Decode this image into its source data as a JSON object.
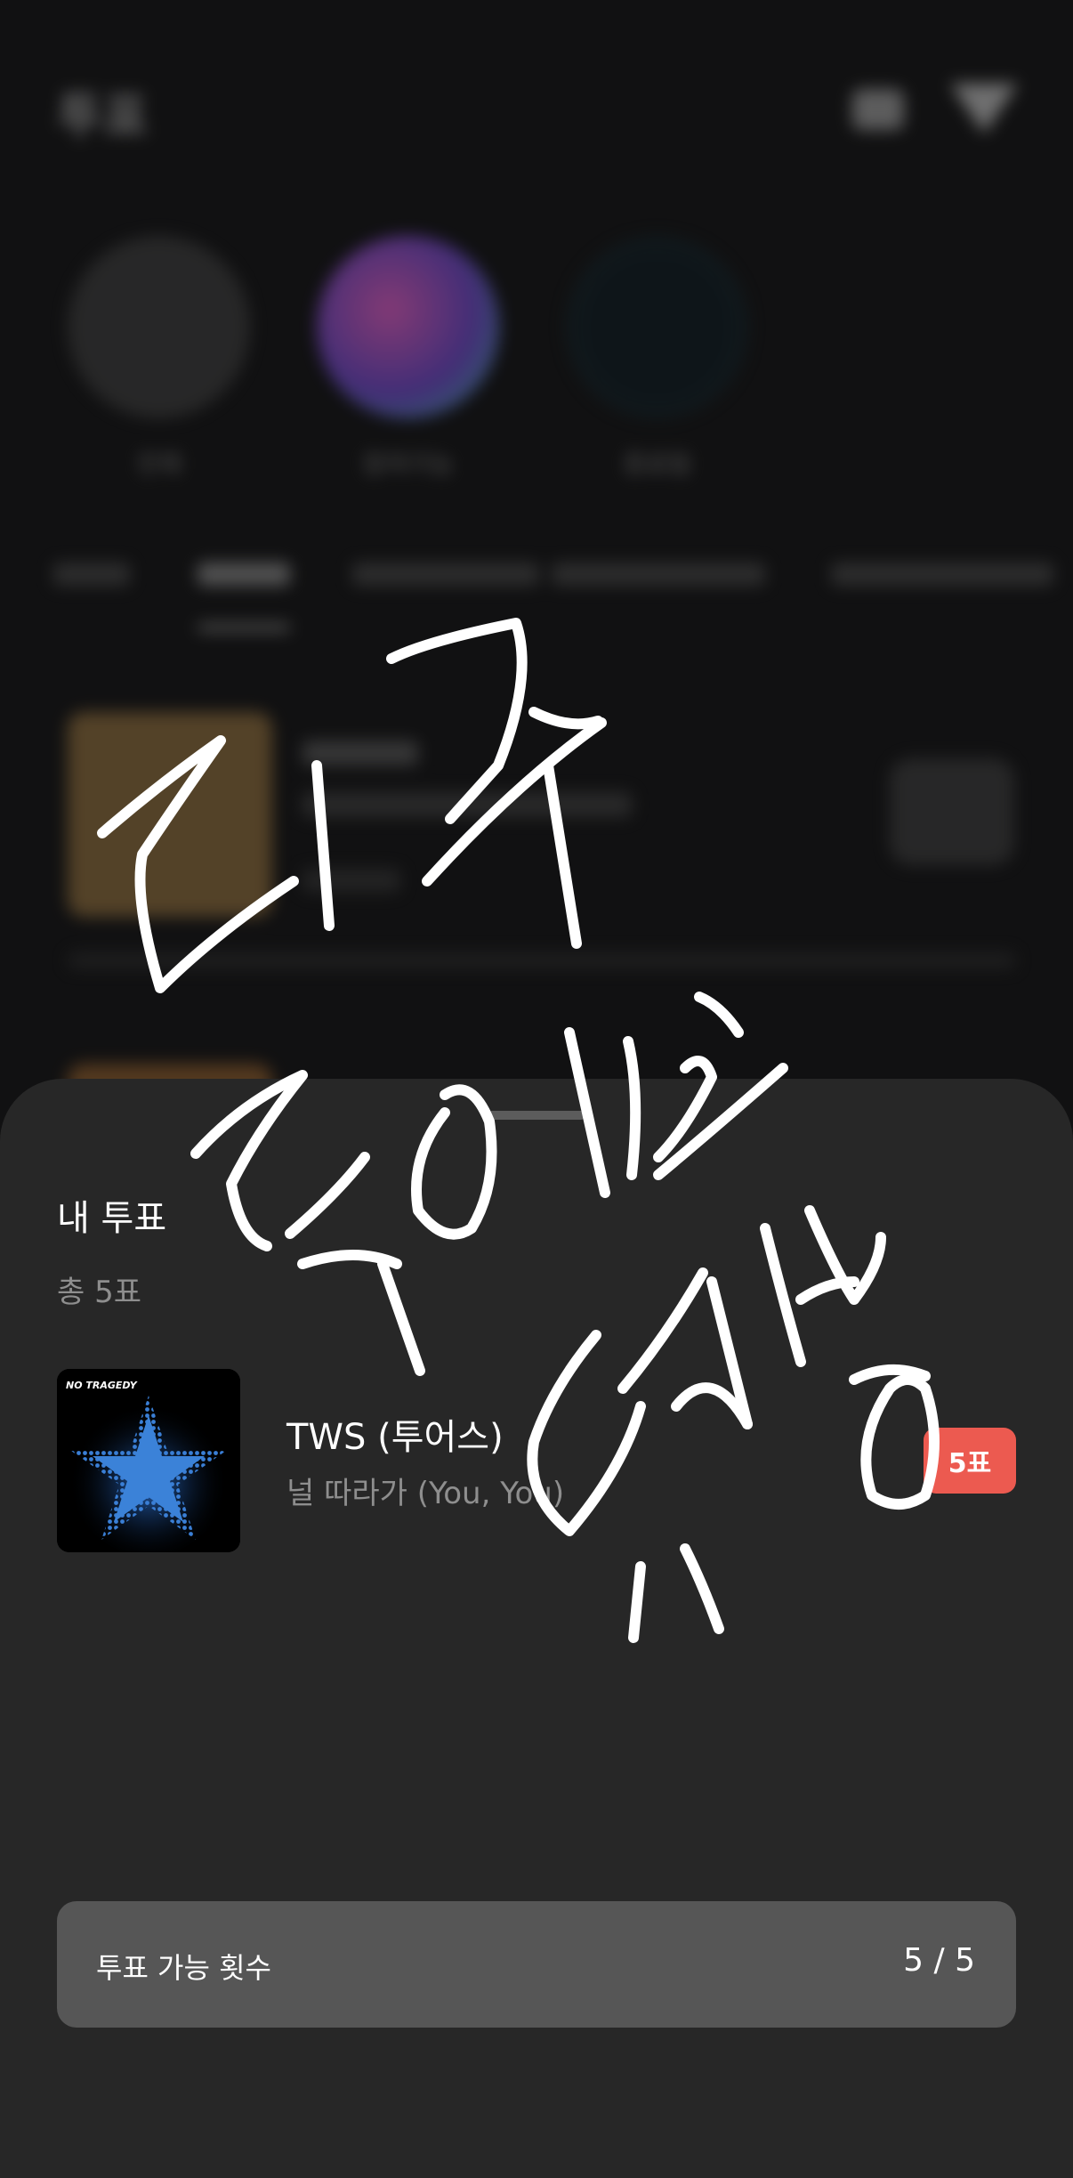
{
  "background": {
    "header_title": "투표",
    "stories": [
      "전체",
      "참여가능",
      "종료됨"
    ]
  },
  "sheet": {
    "title": "내 투표",
    "total": "총 5표",
    "votes": [
      {
        "artist": "TWS (투어스)",
        "song": "널 따라가 (You, You)",
        "badge": "5표",
        "album_art": "tws-no-tragedy-album-art"
      }
    ],
    "vote_limit": {
      "label": "투표 가능 횟수",
      "value": "5 / 5"
    }
  },
  "overlay": {
    "handwriting": "대쿠 투어스 우쌰"
  },
  "colors": {
    "sheet_bg": "#272727",
    "badge": "#ec5a50",
    "count_box": "#565656"
  }
}
